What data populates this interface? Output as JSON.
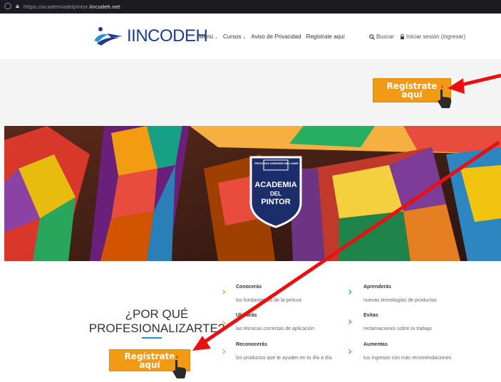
{
  "browser": {
    "url_prefix": "https://academiadelpintor.",
    "url_domain": "iincodeh.net"
  },
  "header": {
    "logo_text": "IINCODEH",
    "nav": [
      {
        "label": "Menú"
      },
      {
        "label": "Cursos"
      },
      {
        "label": "Aviso de Privacidad"
      },
      {
        "label": "Registrate aquí"
      }
    ],
    "search_label": "Buscar",
    "login_label": "Iniciar sesión (ingresar)"
  },
  "hero": {
    "register_line1": "Regístrate",
    "register_line2": "aquí"
  },
  "banner": {
    "badge_brand": "PINTURAS SHERWIN WILLIAMS",
    "badge_title1": "ACADEMIA",
    "badge_title2": "DEL",
    "badge_title3": "PINTOR"
  },
  "section": {
    "why_line1": "¿POR QUÉ",
    "why_line2": "PROFESIONALIZARTE?",
    "register_line1": "Regístrate",
    "register_line2": "aquí",
    "features_left": [
      {
        "title": "Conocerás",
        "desc": "los fundamentos de la pintura"
      },
      {
        "title": "Ubicarás",
        "desc": "las técnicas correctas de aplicación"
      },
      {
        "title": "Reconocerás",
        "desc": "los productos que te ayuden en tu día a día"
      }
    ],
    "features_right": [
      {
        "title": "Aprenderás",
        "desc": "nuevas tecnologías de productos"
      },
      {
        "title": "Evitas",
        "desc": "reclamaciones sobre tu trabajo"
      },
      {
        "title": "Aumentas",
        "desc": "tus ingresos con más recomendaciones"
      }
    ]
  },
  "colors": {
    "accent_orange": "#f29a13",
    "accent_blue": "#1f8fd6",
    "logo_blue": "#1f3c8c",
    "arrow_red": "#e81010"
  }
}
